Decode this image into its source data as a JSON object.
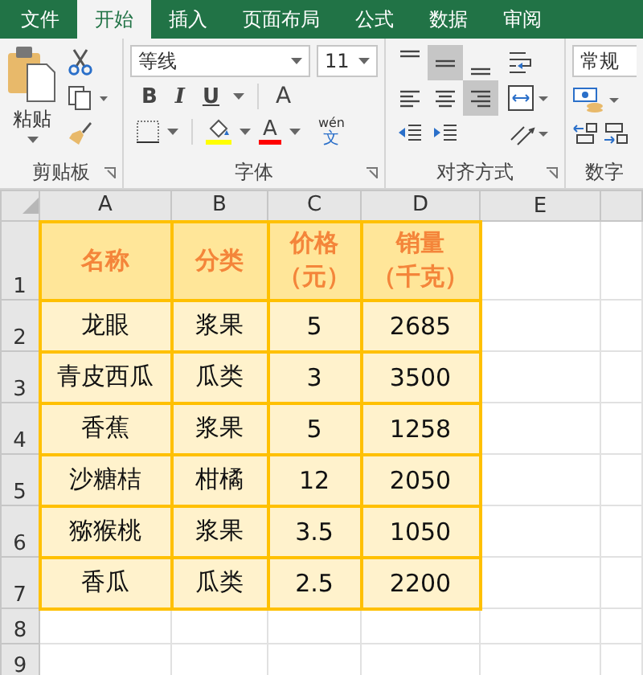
{
  "tabs": [
    {
      "label": "文件",
      "selected": false
    },
    {
      "label": "开始",
      "selected": true
    },
    {
      "label": "插入",
      "selected": false
    },
    {
      "label": "页面布局",
      "selected": false
    },
    {
      "label": "公式",
      "selected": false
    },
    {
      "label": "数据",
      "selected": false
    },
    {
      "label": "审阅",
      "selected": false
    }
  ],
  "ribbon": {
    "clipboard": {
      "paste_label": "粘贴",
      "group_label": "剪贴板"
    },
    "font": {
      "name": "等线",
      "size": "11",
      "bold": "B",
      "italic": "I",
      "underline": "U",
      "grow": "A",
      "color_letter": "A",
      "phonetic_top": "wén",
      "phonetic_bottom": "文",
      "group_label": "字体"
    },
    "alignment": {
      "buttons": [
        {
          "kind": "top",
          "selected": false
        },
        {
          "kind": "middle",
          "selected": true
        },
        {
          "kind": "bottom",
          "selected": false
        },
        {
          "kind": "left",
          "selected": false
        },
        {
          "kind": "center",
          "selected": false
        },
        {
          "kind": "right",
          "selected": true
        }
      ],
      "group_label": "对齐方式"
    },
    "number": {
      "format": "常规",
      "group_label": "数字"
    }
  },
  "sheet": {
    "columns": [
      "A",
      "B",
      "C",
      "D",
      "E"
    ],
    "rows": [
      {
        "number": "1",
        "kind": "header",
        "cells": [
          [
            "名称"
          ],
          [
            "分类"
          ],
          [
            "价格",
            "（元）"
          ],
          [
            "销量",
            "（千克）"
          ]
        ]
      },
      {
        "number": "2",
        "kind": "data",
        "cells": [
          "龙眼",
          "浆果",
          "5",
          "2685"
        ]
      },
      {
        "number": "3",
        "kind": "data",
        "cells": [
          "青皮西瓜",
          "瓜类",
          "3",
          "3500"
        ]
      },
      {
        "number": "4",
        "kind": "data",
        "cells": [
          "香蕉",
          "浆果",
          "5",
          "1258"
        ]
      },
      {
        "number": "5",
        "kind": "data",
        "cells": [
          "沙糖桔",
          "柑橘",
          "12",
          "2050"
        ]
      },
      {
        "number": "6",
        "kind": "data",
        "cells": [
          "猕猴桃",
          "浆果",
          "3.5",
          "1050"
        ]
      },
      {
        "number": "7",
        "kind": "data",
        "cells": [
          "香瓜",
          "瓜类",
          "2.5",
          "2200"
        ]
      },
      {
        "number": "8",
        "kind": "empty",
        "cells": []
      },
      {
        "number": "9",
        "kind": "empty",
        "cells": []
      }
    ]
  }
}
